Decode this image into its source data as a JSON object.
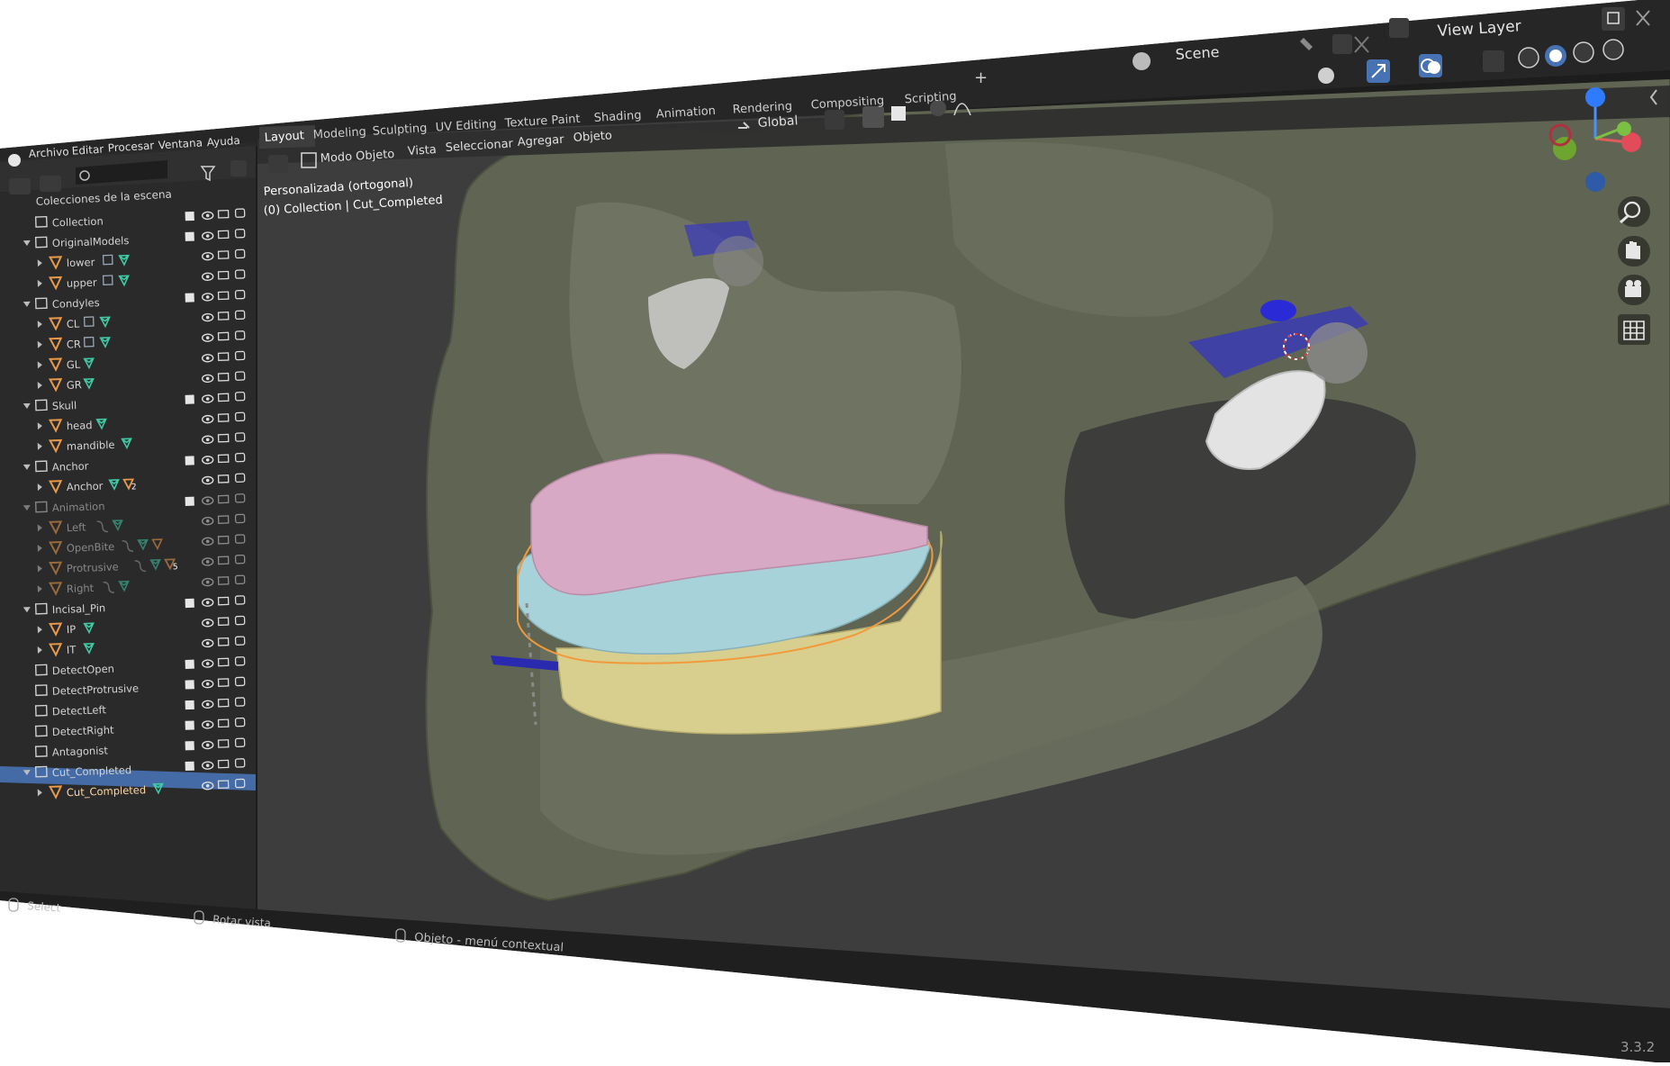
{
  "app": {
    "version": "3.3.2",
    "scene_label": "Scene",
    "view_layer_label": "View Layer"
  },
  "menu": [
    {
      "label": "Archivo"
    },
    {
      "label": "Editar"
    },
    {
      "label": "Procesar"
    },
    {
      "label": "Ventana"
    },
    {
      "label": "Ayuda"
    }
  ],
  "workspace_tabs": [
    {
      "label": "Layout",
      "active": true
    },
    {
      "label": "Modeling"
    },
    {
      "label": "Sculpting"
    },
    {
      "label": "UV Editing"
    },
    {
      "label": "Texture Paint"
    },
    {
      "label": "Shading"
    },
    {
      "label": "Animation"
    },
    {
      "label": "Rendering"
    },
    {
      "label": "Compositing"
    },
    {
      "label": "Scripting"
    }
  ],
  "viewport_header": {
    "mode": "Modo Objeto",
    "menus": [
      "Vista",
      "Seleccionar",
      "Agregar",
      "Objeto"
    ],
    "transform_orientation": "Global"
  },
  "viewport_info": {
    "view_name": "Personalizada (ortogonal)",
    "context": "(0) Collection | Cut_Completed"
  },
  "outliner": {
    "root_label": "Colecciones de la escena",
    "rows": [
      {
        "label": "Collection",
        "kind": "collection",
        "indent": 1,
        "check": true
      },
      {
        "label": "OriginalModels",
        "kind": "collection",
        "indent": 1,
        "check": true,
        "expanded": true
      },
      {
        "label": "lower",
        "kind": "object",
        "indent": 2,
        "mods": 1,
        "mesh": 1
      },
      {
        "label": "upper",
        "kind": "object",
        "indent": 2,
        "mods": 1,
        "mesh": 1
      },
      {
        "label": "Condyles",
        "kind": "collection",
        "indent": 1,
        "check": true,
        "expanded": true
      },
      {
        "label": "CL",
        "kind": "object",
        "indent": 2,
        "mods": 1,
        "mesh": 1
      },
      {
        "label": "CR",
        "kind": "object",
        "indent": 2,
        "mods": 1,
        "mesh": 1
      },
      {
        "label": "GL",
        "kind": "object",
        "indent": 2,
        "mesh": 1
      },
      {
        "label": "GR",
        "kind": "object",
        "indent": 2,
        "mesh": 1
      },
      {
        "label": "Skull",
        "kind": "collection",
        "indent": 1,
        "check": true,
        "expanded": true
      },
      {
        "label": "head",
        "kind": "object",
        "indent": 2,
        "mesh": 1
      },
      {
        "label": "mandible",
        "kind": "object",
        "indent": 2,
        "mesh": 1
      },
      {
        "label": "Anchor",
        "kind": "collection",
        "indent": 1,
        "check": true,
        "expanded": true
      },
      {
        "label": "Anchor",
        "kind": "object",
        "indent": 2,
        "mesh": 1,
        "extra_count": "2"
      },
      {
        "label": "Animation",
        "kind": "collection",
        "indent": 1,
        "check": true,
        "expanded": true,
        "dim": true
      },
      {
        "label": "Left",
        "kind": "object",
        "indent": 2,
        "dim": true,
        "constraint": 1,
        "mesh": 1
      },
      {
        "label": "OpenBite",
        "kind": "object",
        "indent": 2,
        "dim": true,
        "constraint": 1,
        "mesh": 1,
        "obj_extra": 1
      },
      {
        "label": "Protrusive",
        "kind": "object",
        "indent": 2,
        "dim": true,
        "constraint": 1,
        "mesh": 1,
        "extra_count": "5"
      },
      {
        "label": "Right",
        "kind": "object",
        "indent": 2,
        "dim": true,
        "constraint": 1,
        "mesh": 1
      },
      {
        "label": "Incisal_Pin",
        "kind": "collection",
        "indent": 1,
        "check": true,
        "expanded": true
      },
      {
        "label": "IP",
        "kind": "object",
        "indent": 2,
        "mesh": 1
      },
      {
        "label": "IT",
        "kind": "object",
        "indent": 2,
        "mesh": 1
      },
      {
        "label": "DetectOpen",
        "kind": "collection",
        "indent": 1,
        "check": true
      },
      {
        "label": "DetectProtrusive",
        "kind": "collection",
        "indent": 1,
        "check": true
      },
      {
        "label": "DetectLeft",
        "kind": "collection",
        "indent": 1,
        "check": true
      },
      {
        "label": "DetectRight",
        "kind": "collection",
        "indent": 1,
        "check": true
      },
      {
        "label": "Antagonist",
        "kind": "collection",
        "indent": 1,
        "check": true
      },
      {
        "label": "Cut_Completed",
        "kind": "collection",
        "indent": 1,
        "check": true,
        "expanded": true
      },
      {
        "label": "Cut_Completed",
        "kind": "object",
        "indent": 2,
        "mesh": 1,
        "selected": true
      }
    ]
  },
  "status_bar": [
    {
      "label": "Select"
    },
    {
      "label": "Rotar vista"
    },
    {
      "label": "Objeto - menú contextual"
    }
  ],
  "colors": {
    "header_bg": "#303030",
    "panel_bg": "#282828",
    "viewport_bg": "#3d3d3d",
    "selected": "#4772b3",
    "mesh_icon": "#3fc9a5",
    "object_icon": "#e89a4a",
    "skull": "#5d6350",
    "tray": "#d7a9c5",
    "teeth_upper": "#a9d3da",
    "teeth_lower": "#d7cf8d"
  }
}
